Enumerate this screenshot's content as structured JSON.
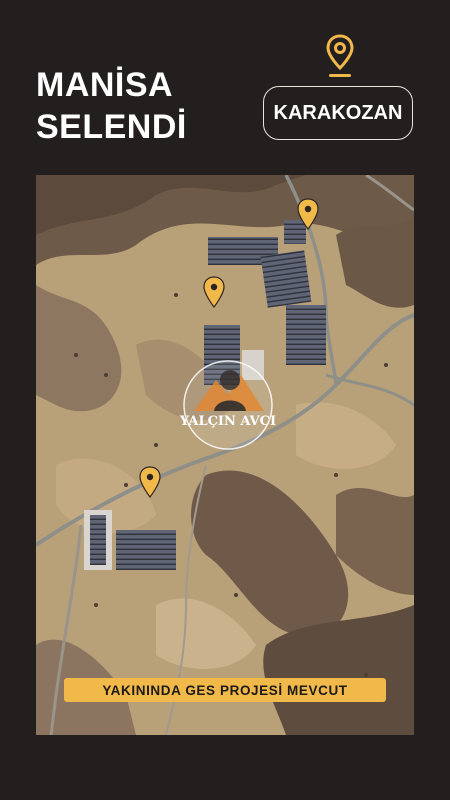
{
  "header": {
    "title_line1": "MANİSA",
    "title_line2": "SELENDİ",
    "location_icon": "location-pin-icon",
    "location_badge": "KARAKOZAN"
  },
  "map": {
    "markers": [
      {
        "name": "map-marker-1",
        "icon": "location-pin-icon"
      },
      {
        "name": "map-marker-2",
        "icon": "location-pin-icon"
      },
      {
        "name": "map-marker-3",
        "icon": "location-pin-icon"
      }
    ],
    "watermark": {
      "logo": "yalcin-avci-logo",
      "text": "YALÇIN AVCI"
    },
    "banner": "YAKININDA GES PROJESİ MEVCUT"
  },
  "colors": {
    "background": "#231f1f",
    "accent": "#f1b84a",
    "text": "#ffffff"
  }
}
